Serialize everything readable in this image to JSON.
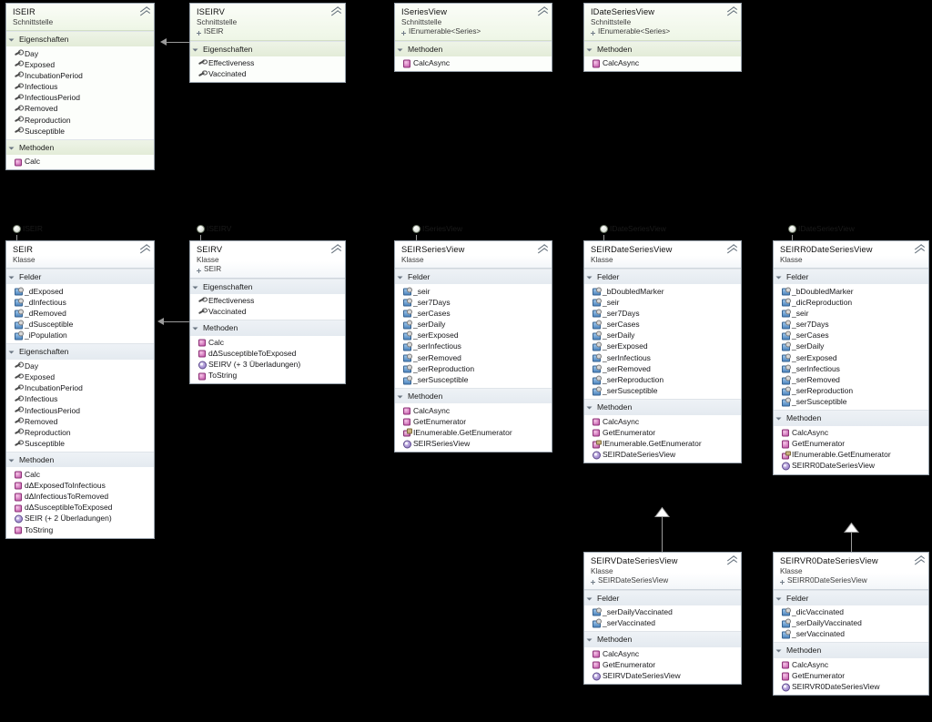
{
  "theme": {
    "background": "#000000",
    "node_border": "#9aa4ae",
    "node_bg": "#ffffff",
    "interface_header": "#eef6e6",
    "class_header": "#f3f6f9",
    "section_header": "#e4eaf0",
    "connector": "#9b9b9b"
  },
  "nodes": [
    {
      "id": "iseir",
      "name": "ISEIR",
      "kind": "Schnittstelle",
      "base": null,
      "sections": [
        {
          "title": "Eigenschaften",
          "members": [
            {
              "icon": "prop",
              "label": "Day"
            },
            {
              "icon": "prop",
              "label": "Exposed"
            },
            {
              "icon": "prop",
              "label": "IncubationPeriod"
            },
            {
              "icon": "prop",
              "label": "Infectious"
            },
            {
              "icon": "prop",
              "label": "InfectiousPeriod"
            },
            {
              "icon": "prop",
              "label": "Removed"
            },
            {
              "icon": "prop",
              "label": "Reproduction"
            },
            {
              "icon": "prop",
              "label": "Susceptible"
            }
          ]
        },
        {
          "title": "Methoden",
          "members": [
            {
              "icon": "meth",
              "label": "Calc"
            }
          ]
        }
      ]
    },
    {
      "id": "iseirv",
      "name": "ISEIRV",
      "kind": "Schnittstelle",
      "base": "ISEIR",
      "sections": [
        {
          "title": "Eigenschaften",
          "members": [
            {
              "icon": "prop",
              "label": "Effectiveness"
            },
            {
              "icon": "prop",
              "label": "Vaccinated"
            }
          ]
        }
      ]
    },
    {
      "id": "iseriesview",
      "name": "ISeriesView",
      "kind": "Schnittstelle",
      "base": "IEnumerable<Series>",
      "sections": [
        {
          "title": "Methoden",
          "members": [
            {
              "icon": "meth",
              "label": "CalcAsync"
            }
          ]
        }
      ]
    },
    {
      "id": "idateseriesview",
      "name": "IDateSeriesView",
      "kind": "Schnittstelle",
      "base": "IEnumerable<Series>",
      "sections": [
        {
          "title": "Methoden",
          "members": [
            {
              "icon": "meth",
              "label": "CalcAsync"
            }
          ]
        }
      ]
    },
    {
      "id": "seir",
      "name": "SEIR",
      "kind": "Klasse",
      "base": null,
      "lollipop": "ISEIR",
      "sections": [
        {
          "title": "Felder",
          "members": [
            {
              "icon": "field",
              "label": "_dExposed"
            },
            {
              "icon": "field",
              "label": "_dInfectious"
            },
            {
              "icon": "field",
              "label": "_dRemoved"
            },
            {
              "icon": "field",
              "label": "_dSusceptible"
            },
            {
              "icon": "field",
              "label": "_iPopulation"
            }
          ]
        },
        {
          "title": "Eigenschaften",
          "members": [
            {
              "icon": "prop",
              "label": "Day"
            },
            {
              "icon": "prop",
              "label": "Exposed"
            },
            {
              "icon": "prop",
              "label": "IncubationPeriod"
            },
            {
              "icon": "prop",
              "label": "Infectious"
            },
            {
              "icon": "prop",
              "label": "InfectiousPeriod"
            },
            {
              "icon": "prop",
              "label": "Removed"
            },
            {
              "icon": "prop",
              "label": "Reproduction"
            },
            {
              "icon": "prop",
              "label": "Susceptible"
            }
          ]
        },
        {
          "title": "Methoden",
          "members": [
            {
              "icon": "meth",
              "label": "Calc"
            },
            {
              "icon": "meth",
              "label": "dΔExposedToInfectious"
            },
            {
              "icon": "meth",
              "label": "dΔInfectiousToRemoved"
            },
            {
              "icon": "meth",
              "label": "dΔSusceptibleToExposed"
            },
            {
              "icon": "ctor",
              "label": "SEIR (+ 2 Überladungen)"
            },
            {
              "icon": "meth",
              "label": "ToString"
            }
          ]
        }
      ]
    },
    {
      "id": "seirv",
      "name": "SEIRV",
      "kind": "Klasse",
      "base": "SEIR",
      "lollipop": "ISEIRV",
      "sections": [
        {
          "title": "Eigenschaften",
          "members": [
            {
              "icon": "prop",
              "label": "Effectiveness"
            },
            {
              "icon": "prop",
              "label": "Vaccinated"
            }
          ]
        },
        {
          "title": "Methoden",
          "members": [
            {
              "icon": "meth",
              "label": "Calc"
            },
            {
              "icon": "meth",
              "label": "dΔSusceptibleToExposed"
            },
            {
              "icon": "ctor",
              "label": "SEIRV (+ 3 Überladungen)"
            },
            {
              "icon": "meth",
              "label": "ToString"
            }
          ]
        }
      ]
    },
    {
      "id": "seirseriesview",
      "name": "SEIRSeriesView",
      "kind": "Klasse",
      "base": null,
      "lollipop": "ISeriesView",
      "sections": [
        {
          "title": "Felder",
          "members": [
            {
              "icon": "field",
              "label": "_seir"
            },
            {
              "icon": "field",
              "label": "_ser7Days"
            },
            {
              "icon": "field",
              "label": "_serCases"
            },
            {
              "icon": "field",
              "label": "_serDaily"
            },
            {
              "icon": "field",
              "label": "_serExposed"
            },
            {
              "icon": "field",
              "label": "_serInfectious"
            },
            {
              "icon": "field",
              "label": "_serRemoved"
            },
            {
              "icon": "field",
              "label": "_serReproduction"
            },
            {
              "icon": "field",
              "label": "_serSusceptible"
            }
          ]
        },
        {
          "title": "Methoden",
          "members": [
            {
              "icon": "meth",
              "label": "CalcAsync"
            },
            {
              "icon": "meth",
              "label": "GetEnumerator"
            },
            {
              "icon": "imeth",
              "label": "IEnumerable.GetEnumerator"
            },
            {
              "icon": "ctor",
              "label": "SEIRSeriesView"
            }
          ]
        }
      ]
    },
    {
      "id": "seirdateseriesview",
      "name": "SEIRDateSeriesView",
      "kind": "Klasse",
      "base": null,
      "lollipop": "IDateSeriesView",
      "sections": [
        {
          "title": "Felder",
          "members": [
            {
              "icon": "field",
              "label": "_bDoubledMarker"
            },
            {
              "icon": "field",
              "label": "_seir"
            },
            {
              "icon": "field",
              "label": "_ser7Days"
            },
            {
              "icon": "field",
              "label": "_serCases"
            },
            {
              "icon": "field",
              "label": "_serDaily"
            },
            {
              "icon": "field",
              "label": "_serExposed"
            },
            {
              "icon": "field",
              "label": "_serInfectious"
            },
            {
              "icon": "field",
              "label": "_serRemoved"
            },
            {
              "icon": "field",
              "label": "_serReproduction"
            },
            {
              "icon": "field",
              "label": "_serSusceptible"
            }
          ]
        },
        {
          "title": "Methoden",
          "members": [
            {
              "icon": "meth",
              "label": "CalcAsync"
            },
            {
              "icon": "meth",
              "label": "GetEnumerator"
            },
            {
              "icon": "imeth",
              "label": "IEnumerable.GetEnumerator"
            },
            {
              "icon": "ctor",
              "label": "SEIRDateSeriesView"
            }
          ]
        }
      ]
    },
    {
      "id": "seirr0dateseriesview",
      "name": "SEIRR0DateSeriesView",
      "kind": "Klasse",
      "base": null,
      "lollipop": "IDateSeriesView",
      "sections": [
        {
          "title": "Felder",
          "members": [
            {
              "icon": "field",
              "label": "_bDoubledMarker"
            },
            {
              "icon": "field",
              "label": "_dicReproduction"
            },
            {
              "icon": "field",
              "label": "_seir"
            },
            {
              "icon": "field",
              "label": "_ser7Days"
            },
            {
              "icon": "field",
              "label": "_serCases"
            },
            {
              "icon": "field",
              "label": "_serDaily"
            },
            {
              "icon": "field",
              "label": "_serExposed"
            },
            {
              "icon": "field",
              "label": "_serInfectious"
            },
            {
              "icon": "field",
              "label": "_serRemoved"
            },
            {
              "icon": "field",
              "label": "_serReproduction"
            },
            {
              "icon": "field",
              "label": "_serSusceptible"
            }
          ]
        },
        {
          "title": "Methoden",
          "members": [
            {
              "icon": "meth",
              "label": "CalcAsync"
            },
            {
              "icon": "meth",
              "label": "GetEnumerator"
            },
            {
              "icon": "imeth",
              "label": "IEnumerable.GetEnumerator"
            },
            {
              "icon": "ctor",
              "label": "SEIRR0DateSeriesView"
            }
          ]
        }
      ]
    },
    {
      "id": "seirvdateseriesview",
      "name": "SEIRVDateSeriesView",
      "kind": "Klasse",
      "base": "SEIRDateSeriesView",
      "sections": [
        {
          "title": "Felder",
          "members": [
            {
              "icon": "field",
              "label": "_serDailyVaccinated"
            },
            {
              "icon": "field",
              "label": "_serVaccinated"
            }
          ]
        },
        {
          "title": "Methoden",
          "members": [
            {
              "icon": "meth",
              "label": "CalcAsync"
            },
            {
              "icon": "meth",
              "label": "GetEnumerator"
            },
            {
              "icon": "ctor",
              "label": "SEIRVDateSeriesView"
            }
          ]
        }
      ]
    },
    {
      "id": "seirvr0dateseriesview",
      "name": "SEIRVR0DateSeriesView",
      "kind": "Klasse",
      "base": "SEIRR0DateSeriesView",
      "sections": [
        {
          "title": "Felder",
          "members": [
            {
              "icon": "field",
              "label": "_dicVaccinated"
            },
            {
              "icon": "field",
              "label": "_serDailyVaccinated"
            },
            {
              "icon": "field",
              "label": "_serVaccinated"
            }
          ]
        },
        {
          "title": "Methoden",
          "members": [
            {
              "icon": "meth",
              "label": "CalcAsync"
            },
            {
              "icon": "meth",
              "label": "GetEnumerator"
            },
            {
              "icon": "ctor",
              "label": "SEIRVR0DateSeriesView"
            }
          ]
        }
      ]
    }
  ]
}
